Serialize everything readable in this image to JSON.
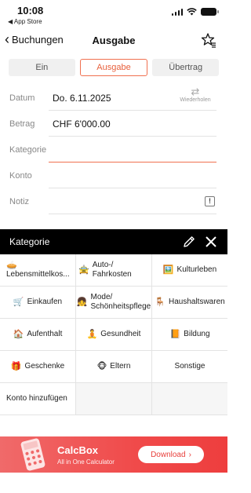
{
  "status_bar": {
    "time": "10:08",
    "back_app": "◀ App Store"
  },
  "nav": {
    "back_label": "Buchungen",
    "title": "Ausgabe"
  },
  "tabs": [
    {
      "label": "Ein",
      "active": false
    },
    {
      "label": "Ausgabe",
      "active": true
    },
    {
      "label": "Übertrag",
      "active": false
    }
  ],
  "form": {
    "date_label": "Datum",
    "date_value": "Do. 6.11.2025",
    "repeat_label": "Wiederholen",
    "amount_label": "Betrag",
    "amount_value": "CHF 6'000.00",
    "category_label": "Kategorie",
    "account_label": "Konto",
    "note_label": "Notiz"
  },
  "category_panel": {
    "title": "Kategorie",
    "items": [
      {
        "emoji": "🥧",
        "label": "Lebensmittelkos..."
      },
      {
        "emoji": "🚖",
        "label": "Auto-/ Fahrkosten"
      },
      {
        "emoji": "🖼️",
        "label": "Kulturleben"
      },
      {
        "emoji": "🛒",
        "label": "Einkaufen"
      },
      {
        "emoji": "👧",
        "label": "Mode/ Schönheitspflege"
      },
      {
        "emoji": "🪑",
        "label": "Haushaltswaren"
      },
      {
        "emoji": "🏠",
        "label": "Aufenthalt"
      },
      {
        "emoji": "🧘",
        "label": "Gesundheit"
      },
      {
        "emoji": "📙",
        "label": "Bildung"
      },
      {
        "emoji": "🎁",
        "label": "Geschenke"
      },
      {
        "emoji": "🐵",
        "label": "Eltern"
      },
      {
        "emoji": "",
        "label": "Sonstige"
      },
      {
        "emoji": "",
        "label": "Konto hinzufügen"
      }
    ]
  },
  "ad": {
    "app_name": "CalcBox",
    "subtitle": "All in One Calculator",
    "download_label": "Download",
    "download_chevron": "›"
  },
  "colors": {
    "accent": "#e8603c",
    "panel_header": "#000000",
    "ad_background": "#f04a4a"
  }
}
